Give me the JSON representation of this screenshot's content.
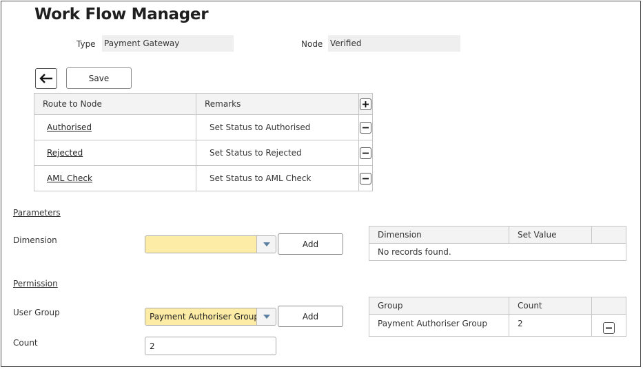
{
  "header": {
    "title": "Work Flow Manager"
  },
  "info": {
    "type_label": "Type",
    "type_value": "Payment Gateway",
    "node_label": "Node",
    "node_value": "Verified"
  },
  "toolbar": {
    "back_icon": "left-arrow-icon",
    "save_label": "Save"
  },
  "routes": {
    "columns": [
      "Route to Node",
      "Remarks"
    ],
    "add_icon": "plus-icon",
    "rows": [
      {
        "node": "Authorised",
        "remarks": "Set Status to Authorised",
        "remove_icon": "minus-icon"
      },
      {
        "node": "Rejected",
        "remarks": "Set Status to Rejected",
        "remove_icon": "minus-icon"
      },
      {
        "node": "AML Check",
        "remarks": "Set Status to AML Check",
        "remove_icon": "minus-icon"
      }
    ]
  },
  "parameters": {
    "section_label": "Parameters",
    "dimension_label": "Dimension",
    "dimension_value": "",
    "add_label": "Add",
    "table": {
      "columns": [
        "Dimension",
        "Set Value"
      ],
      "empty_text": "No records found."
    }
  },
  "permission": {
    "section_label": "Permission",
    "user_group_label": "User Group",
    "user_group_value": "Payment Authoriser Group",
    "add_label": "Add",
    "count_label": "Count",
    "count_value": "2",
    "table": {
      "columns": [
        "Group",
        "Count"
      ],
      "rows": [
        {
          "group": "Payment Authoriser Group",
          "count": "2",
          "remove_icon": "minus-icon"
        }
      ]
    }
  }
}
